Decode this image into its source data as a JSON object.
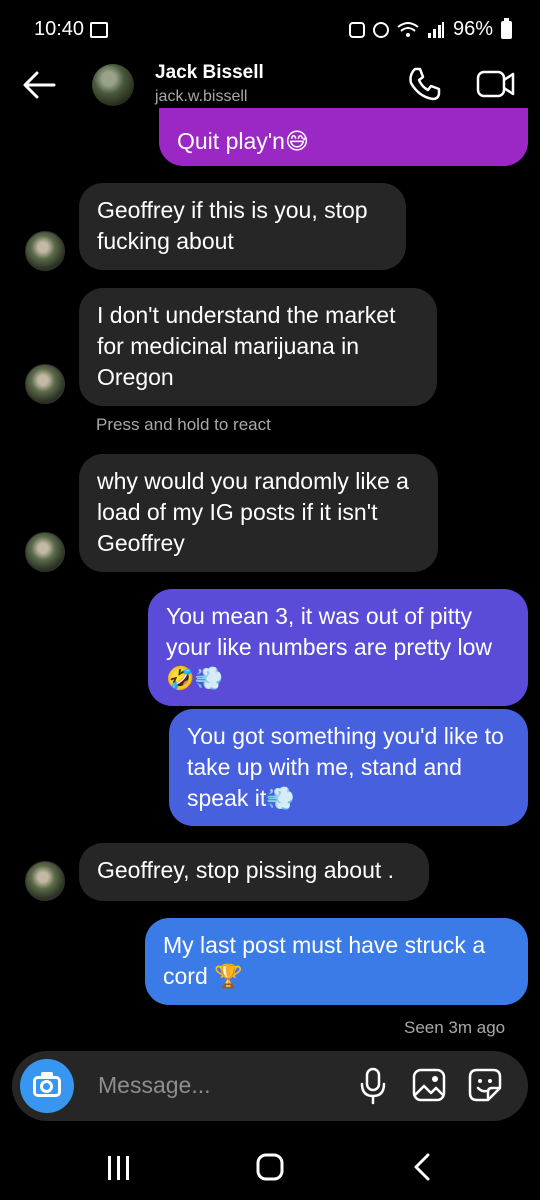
{
  "status_bar": {
    "time": "10:40",
    "battery": "96%"
  },
  "header": {
    "name": "Jack Bissell",
    "username": "jack.w.bissell"
  },
  "messages": [
    {
      "text": "Quit play'n😅",
      "direction": "outgoing"
    },
    {
      "text": "Geoffrey if this is you, stop fucking about",
      "direction": "incoming"
    },
    {
      "text": "I don't understand the market for medicinal marijuana in Oregon",
      "direction": "incoming"
    },
    {
      "text": "why would you randomly like a load of my IG posts if it isn't Geoffrey",
      "direction": "incoming"
    },
    {
      "text": "You mean 3, it was out of pitty your like numbers are pretty low 🤣💨",
      "direction": "outgoing"
    },
    {
      "text": "You got something you'd like to take up with me, stand and speak it💨",
      "direction": "outgoing"
    },
    {
      "text": "Geoffrey, stop pissing about .",
      "direction": "incoming"
    },
    {
      "text": "My last post must have struck a cord 🏆",
      "direction": "outgoing"
    }
  ],
  "hint": "Press and hold to react",
  "seen": "Seen 3m ago",
  "composer": {
    "placeholder": "Message..."
  },
  "colors": {
    "incoming_bubble": "#262626",
    "outgoing_top": "#9b27c4",
    "outgoing_mid": "#5a4bd9",
    "outgoing_bottom": "#3b7be8",
    "camera_button": "#3797f0"
  }
}
